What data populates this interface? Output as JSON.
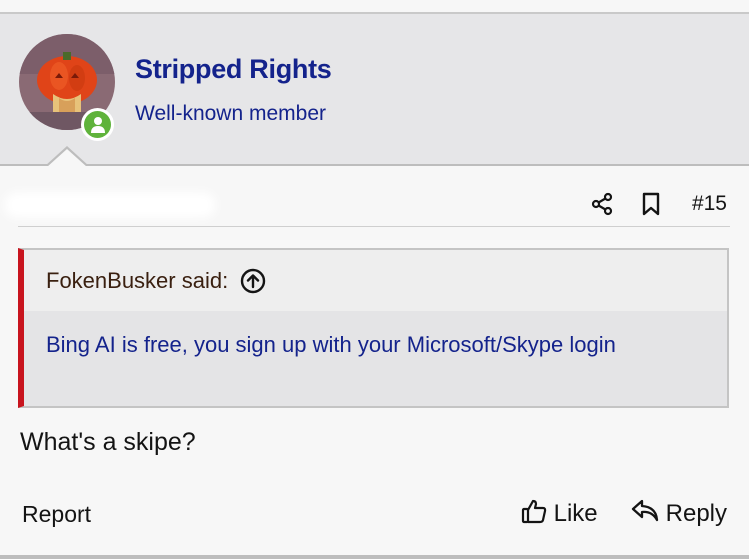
{
  "user": {
    "name": "Stripped Rights",
    "title": "Well-known member",
    "avatar_icon": "pumpkin-avatar",
    "status_icon": "online-status-icon",
    "status_color": "#5fb33b"
  },
  "post_header": {
    "share_icon": "share-icon",
    "bookmark_icon": "bookmark-icon",
    "post_number": "#15"
  },
  "quote": {
    "author_said": "FokenBusker said:",
    "jump_icon": "arrow-up-circle-icon",
    "text": "Bing AI is free, you sign up with your Microsoft/Skype login"
  },
  "message": "What's a skipe?",
  "footer": {
    "report_label": "Report",
    "like_label": "Like",
    "reply_label": "Reply"
  },
  "colors": {
    "link": "#14238c",
    "quote_accent": "#c8141e"
  }
}
